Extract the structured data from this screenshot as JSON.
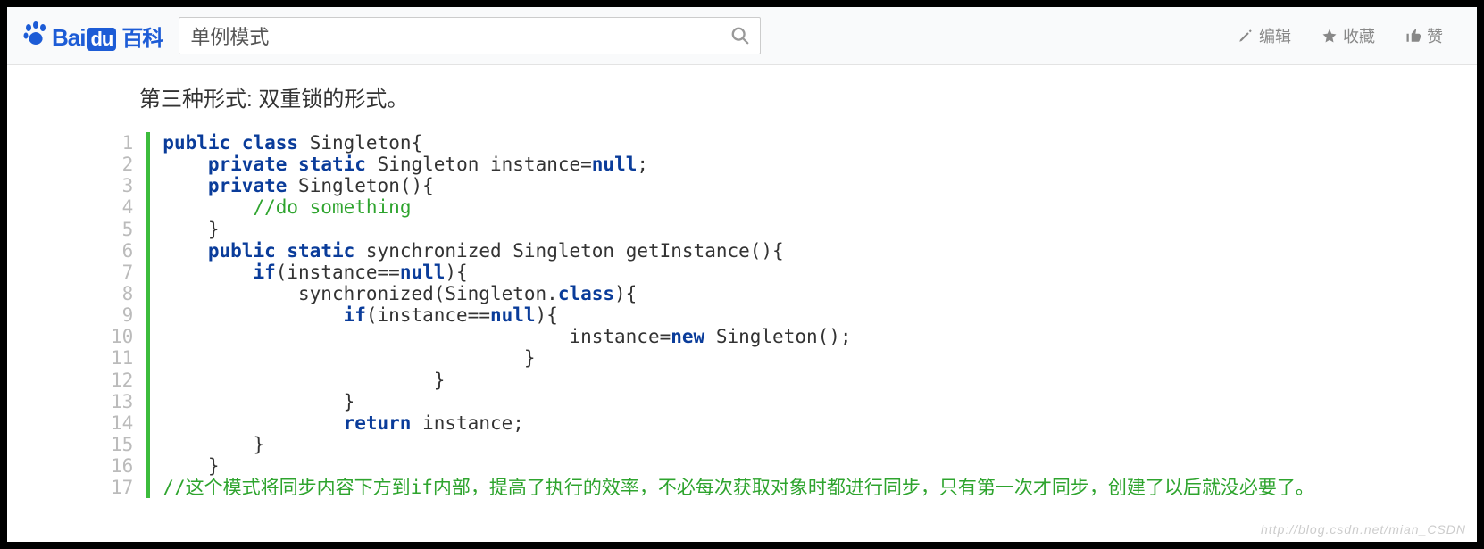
{
  "header": {
    "logo": {
      "bai": "Bai",
      "du": "du",
      "baike_cn": "百科"
    },
    "search": {
      "value": "单例模式"
    },
    "actions": {
      "edit": "编辑",
      "favorite": "收藏",
      "like": "赞"
    }
  },
  "article": {
    "section_title": "第三种形式: 双重锁的形式。",
    "code": {
      "line_count": 17,
      "tokens": [
        [
          {
            "t": "kw",
            "v": "public"
          },
          {
            "t": "sp",
            "v": " "
          },
          {
            "t": "kw",
            "v": "class"
          },
          {
            "t": "sp",
            "v": " "
          },
          {
            "t": "txt",
            "v": "Singleton{"
          }
        ],
        [
          {
            "t": "sp",
            "v": "    "
          },
          {
            "t": "kw",
            "v": "private"
          },
          {
            "t": "sp",
            "v": " "
          },
          {
            "t": "kw",
            "v": "static"
          },
          {
            "t": "sp",
            "v": " "
          },
          {
            "t": "txt",
            "v": "Singleton instance="
          },
          {
            "t": "kw",
            "v": "null"
          },
          {
            "t": "txt",
            "v": ";"
          }
        ],
        [
          {
            "t": "sp",
            "v": "    "
          },
          {
            "t": "kw",
            "v": "private"
          },
          {
            "t": "sp",
            "v": " "
          },
          {
            "t": "txt",
            "v": "Singleton(){"
          }
        ],
        [
          {
            "t": "sp",
            "v": "        "
          },
          {
            "t": "cmt",
            "v": "//do something"
          }
        ],
        [
          {
            "t": "sp",
            "v": "    "
          },
          {
            "t": "txt",
            "v": "}"
          }
        ],
        [
          {
            "t": "sp",
            "v": "    "
          },
          {
            "t": "kw",
            "v": "public"
          },
          {
            "t": "sp",
            "v": " "
          },
          {
            "t": "kw",
            "v": "static"
          },
          {
            "t": "sp",
            "v": " "
          },
          {
            "t": "txt",
            "v": "synchronized Singleton getInstance(){"
          }
        ],
        [
          {
            "t": "sp",
            "v": "        "
          },
          {
            "t": "kw",
            "v": "if"
          },
          {
            "t": "txt",
            "v": "(instance=="
          },
          {
            "t": "kw",
            "v": "null"
          },
          {
            "t": "txt",
            "v": "){"
          }
        ],
        [
          {
            "t": "sp",
            "v": "            "
          },
          {
            "t": "txt",
            "v": "synchronized(Singleton."
          },
          {
            "t": "kw",
            "v": "class"
          },
          {
            "t": "txt",
            "v": "){"
          }
        ],
        [
          {
            "t": "sp",
            "v": "                "
          },
          {
            "t": "kw",
            "v": "if"
          },
          {
            "t": "txt",
            "v": "(instance=="
          },
          {
            "t": "kw",
            "v": "null"
          },
          {
            "t": "txt",
            "v": "){"
          }
        ],
        [
          {
            "t": "sp",
            "v": "                                    "
          },
          {
            "t": "txt",
            "v": "instance="
          },
          {
            "t": "kw",
            "v": "new"
          },
          {
            "t": "sp",
            "v": " "
          },
          {
            "t": "txt",
            "v": "Singleton();"
          }
        ],
        [
          {
            "t": "sp",
            "v": "                                "
          },
          {
            "t": "txt",
            "v": "}"
          }
        ],
        [
          {
            "t": "sp",
            "v": "                        "
          },
          {
            "t": "txt",
            "v": "}"
          }
        ],
        [
          {
            "t": "sp",
            "v": "                "
          },
          {
            "t": "txt",
            "v": "}"
          }
        ],
        [
          {
            "t": "sp",
            "v": "                "
          },
          {
            "t": "kw",
            "v": "return"
          },
          {
            "t": "sp",
            "v": " "
          },
          {
            "t": "txt",
            "v": "instance;"
          }
        ],
        [
          {
            "t": "sp",
            "v": "        "
          },
          {
            "t": "txt",
            "v": "}"
          }
        ],
        [
          {
            "t": "sp",
            "v": "    "
          },
          {
            "t": "txt",
            "v": "}"
          }
        ],
        [
          {
            "t": "cmt",
            "v": "//这个模式将同步内容下方到if内部，提高了执行的效率，不必每次获取对象时都进行同步，只有第一次才同步，创建了以后就没必要了。"
          }
        ]
      ]
    }
  },
  "watermark": "http://blog.csdn.net/mian_CSDN"
}
